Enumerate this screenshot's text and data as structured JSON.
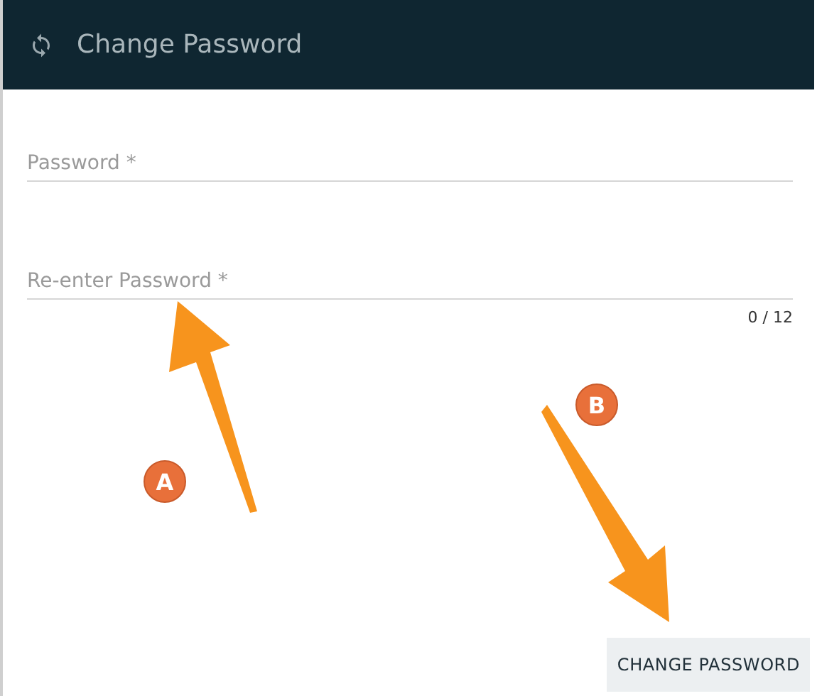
{
  "header": {
    "title": "Change Password"
  },
  "fields": [
    {
      "placeholder": "Password *"
    },
    {
      "placeholder": "Re-enter Password *",
      "counter": "0 / 12"
    }
  ],
  "button": {
    "label": "CHANGE PASSWORD"
  },
  "annotations": [
    {
      "label": "A"
    },
    {
      "label": "B"
    }
  ]
}
